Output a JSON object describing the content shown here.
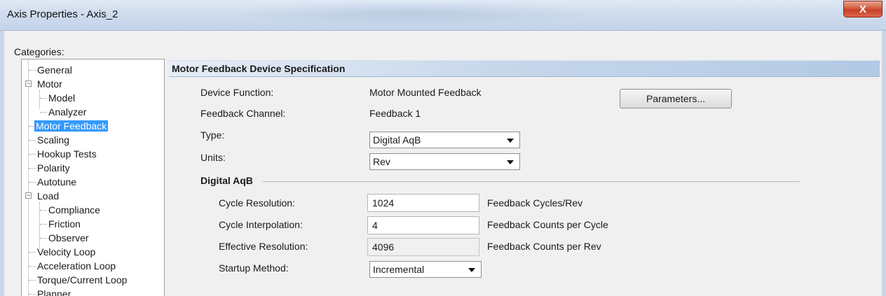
{
  "window": {
    "title": "Axis Properties - Axis_2",
    "close_label": "X"
  },
  "categories_label": "Categories:",
  "tree": [
    {
      "label": "General"
    },
    {
      "label": "Motor"
    },
    {
      "label": "Model"
    },
    {
      "label": "Analyzer"
    },
    {
      "label": "Motor Feedback"
    },
    {
      "label": "Scaling"
    },
    {
      "label": "Hookup Tests"
    },
    {
      "label": "Polarity"
    },
    {
      "label": "Autotune"
    },
    {
      "label": "Load"
    },
    {
      "label": "Compliance"
    },
    {
      "label": "Friction"
    },
    {
      "label": "Observer"
    },
    {
      "label": "Velocity Loop"
    },
    {
      "label": "Acceleration Loop"
    },
    {
      "label": "Torque/Current Loop"
    },
    {
      "label": "Planner"
    }
  ],
  "panel": {
    "header": "Motor Feedback Device Specification",
    "device_function_label": "Device Function:",
    "device_function_value": "Motor Mounted Feedback",
    "feedback_channel_label": "Feedback Channel:",
    "feedback_channel_value": "Feedback 1",
    "parameters_button": "Parameters...",
    "type_label": "Type:",
    "type_value": "Digital AqB",
    "units_label": "Units:",
    "units_value": "Rev",
    "section_title": "Digital AqB",
    "cycle_resolution_label": "Cycle Resolution:",
    "cycle_resolution_value": "1024",
    "cycle_resolution_unit": "Feedback Cycles/Rev",
    "cycle_interpolation_label": "Cycle Interpolation:",
    "cycle_interpolation_value": "4",
    "cycle_interpolation_unit": "Feedback Counts per Cycle",
    "effective_resolution_label": "Effective Resolution:",
    "effective_resolution_value": "4096",
    "effective_resolution_unit": "Feedback Counts per Rev",
    "startup_method_label": "Startup Method:",
    "startup_method_value": "Incremental"
  }
}
